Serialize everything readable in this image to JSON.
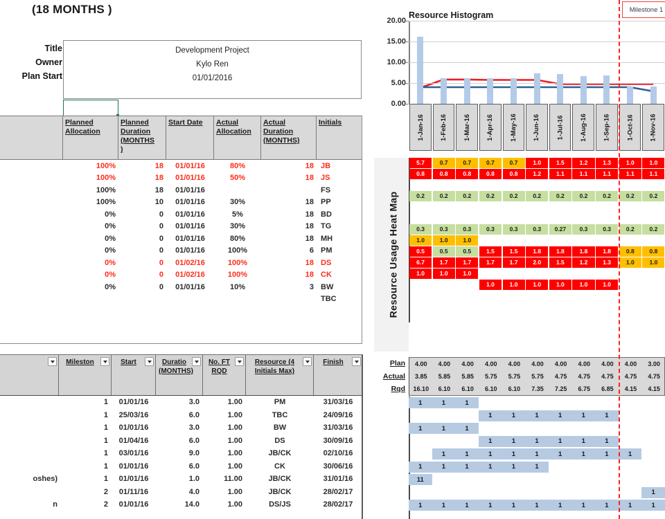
{
  "project": {
    "title_banner": "(18 MONTHS )",
    "labels": [
      "Title",
      "Owner",
      "Plan Start"
    ],
    "values": [
      "Development Project",
      "Kylo Ren",
      "01/01/2016"
    ]
  },
  "resource_table": {
    "headers": [
      "",
      "Planned Allocation",
      "Planned Duration (MONTHS )",
      "Start Date",
      "Actual Allocation",
      "Actual Duration (MONTHS)",
      "Initials"
    ],
    "header_lines": [
      [
        ""
      ],
      [
        "Planned",
        "Allocation"
      ],
      [
        "Planned",
        "Duration",
        "(MONTHS",
        ")"
      ],
      [
        "Start Date"
      ],
      [
        "Actual",
        "Allocation"
      ],
      [
        "Actual",
        "Duration",
        "(MONTHS)"
      ],
      [
        "Initials"
      ]
    ],
    "rows": [
      {
        "planned_allocation": "100%",
        "planned_duration": "18",
        "start_date": "01/01/16",
        "actual_allocation": "80%",
        "actual_duration": "18",
        "initials": "JB",
        "highlight": "red"
      },
      {
        "planned_allocation": "100%",
        "planned_duration": "18",
        "start_date": "01/01/16",
        "actual_allocation": "50%",
        "actual_duration": "18",
        "initials": "JS",
        "highlight": "red"
      },
      {
        "planned_allocation": "100%",
        "planned_duration": "18",
        "start_date": "01/01/16",
        "actual_allocation": "",
        "actual_duration": "",
        "initials": "FS",
        "highlight": "black"
      },
      {
        "planned_allocation": "100%",
        "planned_duration": "10",
        "start_date": "01/01/16",
        "actual_allocation": "30%",
        "actual_duration": "18",
        "initials": "PP",
        "highlight": "black"
      },
      {
        "planned_allocation": "0%",
        "planned_duration": "0",
        "start_date": "01/01/16",
        "actual_allocation": "5%",
        "actual_duration": "18",
        "initials": "BD",
        "highlight": "black"
      },
      {
        "planned_allocation": "0%",
        "planned_duration": "0",
        "start_date": "01/01/16",
        "actual_allocation": "30%",
        "actual_duration": "18",
        "initials": "TG",
        "highlight": "black"
      },
      {
        "planned_allocation": "0%",
        "planned_duration": "0",
        "start_date": "01/01/16",
        "actual_allocation": "80%",
        "actual_duration": "18",
        "initials": "MH",
        "highlight": "black"
      },
      {
        "planned_allocation": "0%",
        "planned_duration": "0",
        "start_date": "01/01/16",
        "actual_allocation": "100%",
        "actual_duration": "6",
        "initials": "PM",
        "highlight": "black"
      },
      {
        "planned_allocation": "0%",
        "planned_duration": "0",
        "start_date": "01/02/16",
        "actual_allocation": "100%",
        "actual_duration": "18",
        "initials": "DS",
        "highlight": "red"
      },
      {
        "planned_allocation": "0%",
        "planned_duration": "0",
        "start_date": "01/02/16",
        "actual_allocation": "100%",
        "actual_duration": "18",
        "initials": "CK",
        "highlight": "red"
      },
      {
        "planned_allocation": "0%",
        "planned_duration": "0",
        "start_date": "01/01/16",
        "actual_allocation": "10%",
        "actual_duration": "3",
        "initials": "BW",
        "highlight": "black"
      },
      {
        "planned_allocation": "",
        "planned_duration": "",
        "start_date": "",
        "actual_allocation": "",
        "actual_duration": "",
        "initials": "TBC",
        "highlight": "black"
      }
    ]
  },
  "task_table": {
    "header_lines": [
      [
        ""
      ],
      [
        "Mileston"
      ],
      [
        "Start"
      ],
      [
        "Duratio",
        "(MONTHS)"
      ],
      [
        "No. FT",
        "RQD"
      ],
      [
        "Resource (4",
        "Initials Max)"
      ],
      [
        "Finish"
      ]
    ],
    "filter_icon": "chevron-down-icon",
    "rows": [
      {
        "desc": "",
        "milestone": "1",
        "start": "01/01/16",
        "duration": "3.0",
        "fte": "1.00",
        "resource": "PM",
        "finish": "31/03/16"
      },
      {
        "desc": "",
        "milestone": "1",
        "start": "25/03/16",
        "duration": "6.0",
        "fte": "1.00",
        "resource": "TBC",
        "finish": "24/09/16"
      },
      {
        "desc": "",
        "milestone": "1",
        "start": "01/01/16",
        "duration": "3.0",
        "fte": "1.00",
        "resource": "BW",
        "finish": "31/03/16"
      },
      {
        "desc": "",
        "milestone": "1",
        "start": "01/04/16",
        "duration": "6.0",
        "fte": "1.00",
        "resource": "DS",
        "finish": "30/09/16"
      },
      {
        "desc": "",
        "milestone": "1",
        "start": "03/01/16",
        "duration": "9.0",
        "fte": "1.00",
        "resource": "JB/CK",
        "finish": "02/10/16"
      },
      {
        "desc": "",
        "milestone": "1",
        "start": "01/01/16",
        "duration": "6.0",
        "fte": "1.00",
        "resource": "CK",
        "finish": "30/06/16"
      },
      {
        "desc": "oshes)",
        "milestone": "1",
        "start": "01/01/16",
        "duration": "1.0",
        "fte": "11.00",
        "resource": "JB/CK",
        "finish": "31/01/16"
      },
      {
        "desc": "",
        "milestone": "2",
        "start": "01/11/16",
        "duration": "4.0",
        "fte": "1.00",
        "resource": "JB/CK",
        "finish": "28/02/17"
      },
      {
        "desc": "n",
        "milestone": "2",
        "start": "01/01/16",
        "duration": "14.0",
        "fte": "1.00",
        "resource": "DS/JS",
        "finish": "28/02/17"
      }
    ]
  },
  "milestone": {
    "label": "Milestone 1",
    "at_column": 9
  },
  "heatmap": {
    "title": "Resource Usage Heat Map",
    "colors": {
      "red": "#ff0000",
      "amber": "#ffbf00",
      "green": "#c6dea0"
    },
    "rows": [
      {
        "cells": [
          {
            "v": "5.7",
            "c": "red"
          },
          {
            "v": "0.7",
            "c": "amber"
          },
          {
            "v": "0.7",
            "c": "amber"
          },
          {
            "v": "0.7",
            "c": "amber"
          },
          {
            "v": "0.7",
            "c": "amber"
          },
          {
            "v": "1.0",
            "c": "red"
          },
          {
            "v": "1.5",
            "c": "red"
          },
          {
            "v": "1.2",
            "c": "red"
          },
          {
            "v": "1.3",
            "c": "red"
          },
          {
            "v": "1.0",
            "c": "red"
          },
          {
            "v": "1.0",
            "c": "red"
          }
        ]
      },
      {
        "cells": [
          {
            "v": "0.8",
            "c": "red"
          },
          {
            "v": "0.8",
            "c": "red"
          },
          {
            "v": "0.8",
            "c": "red"
          },
          {
            "v": "0.8",
            "c": "red"
          },
          {
            "v": "0.8",
            "c": "red"
          },
          {
            "v": "1.2",
            "c": "red"
          },
          {
            "v": "1.1",
            "c": "red"
          },
          {
            "v": "1.1",
            "c": "red"
          },
          {
            "v": "1.1",
            "c": "red"
          },
          {
            "v": "1.1",
            "c": "red"
          },
          {
            "v": "1.1",
            "c": "red"
          }
        ]
      },
      {
        "cells": []
      },
      {
        "cells": [
          {
            "v": "0.2",
            "c": "green"
          },
          {
            "v": "0.2",
            "c": "green"
          },
          {
            "v": "0.2",
            "c": "green"
          },
          {
            "v": "0.2",
            "c": "green"
          },
          {
            "v": "0.2",
            "c": "green"
          },
          {
            "v": "0.2",
            "c": "green"
          },
          {
            "v": "0.2",
            "c": "green"
          },
          {
            "v": "0.2",
            "c": "green"
          },
          {
            "v": "0.2",
            "c": "green"
          },
          {
            "v": "0.2",
            "c": "green"
          },
          {
            "v": "0.2",
            "c": "green"
          }
        ]
      },
      {
        "cells": []
      },
      {
        "cells": []
      },
      {
        "cells": [
          {
            "v": "0.3",
            "c": "green"
          },
          {
            "v": "0.3",
            "c": "green"
          },
          {
            "v": "0.3",
            "c": "green"
          },
          {
            "v": "0.3",
            "c": "green"
          },
          {
            "v": "0.3",
            "c": "green"
          },
          {
            "v": "0.3",
            "c": "green"
          },
          {
            "v": "0.27",
            "c": "green"
          },
          {
            "v": "0.3",
            "c": "green"
          },
          {
            "v": "0.3",
            "c": "green"
          },
          {
            "v": "0.2",
            "c": "green"
          },
          {
            "v": "0.2",
            "c": "green"
          }
        ]
      },
      {
        "cells": [
          {
            "v": "1.0",
            "c": "amber"
          },
          {
            "v": "1.0",
            "c": "amber"
          },
          {
            "v": "1.0",
            "c": "amber"
          },
          null,
          null,
          null,
          null,
          null,
          null,
          null,
          null
        ]
      },
      {
        "cells": [
          {
            "v": "0.5",
            "c": "red"
          },
          {
            "v": "0.5",
            "c": "green"
          },
          {
            "v": "0.5",
            "c": "green"
          },
          {
            "v": "1.5",
            "c": "red"
          },
          {
            "v": "1.5",
            "c": "red"
          },
          {
            "v": "1.8",
            "c": "red"
          },
          {
            "v": "1.8",
            "c": "red"
          },
          {
            "v": "1.8",
            "c": "red"
          },
          {
            "v": "1.8",
            "c": "red"
          },
          {
            "v": "0.8",
            "c": "amber"
          },
          {
            "v": "0.8",
            "c": "amber"
          }
        ]
      },
      {
        "cells": [
          {
            "v": "6.7",
            "c": "red"
          },
          {
            "v": "1.7",
            "c": "red"
          },
          {
            "v": "1.7",
            "c": "red"
          },
          {
            "v": "1.7",
            "c": "red"
          },
          {
            "v": "1.7",
            "c": "red"
          },
          {
            "v": "2.0",
            "c": "red"
          },
          {
            "v": "1.5",
            "c": "red"
          },
          {
            "v": "1.2",
            "c": "red"
          },
          {
            "v": "1.3",
            "c": "red"
          },
          {
            "v": "1.0",
            "c": "amber"
          },
          {
            "v": "1.0",
            "c": "amber"
          }
        ]
      },
      {
        "cells": [
          {
            "v": "1.0",
            "c": "red"
          },
          {
            "v": "1.0",
            "c": "red"
          },
          {
            "v": "1.0",
            "c": "red"
          },
          null,
          null,
          null,
          null,
          null,
          null,
          null,
          null
        ]
      },
      {
        "cells": [
          null,
          null,
          null,
          {
            "v": "1.0",
            "c": "red"
          },
          {
            "v": "1.0",
            "c": "red"
          },
          {
            "v": "1.0",
            "c": "red"
          },
          {
            "v": "1.0",
            "c": "red"
          },
          {
            "v": "1.0",
            "c": "red"
          },
          {
            "v": "1.0",
            "c": "red"
          },
          null,
          null
        ]
      }
    ]
  },
  "summary": {
    "row_labels": [
      "Plan",
      "Actual",
      "Rqd"
    ],
    "plan": [
      "4.00",
      "4.00",
      "4.00",
      "4.00",
      "4.00",
      "4.00",
      "4.00",
      "4.00",
      "4.00",
      "4.00",
      "3.00"
    ],
    "actual": [
      "3.85",
      "5.85",
      "5.85",
      "5.75",
      "5.75",
      "5.75",
      "4.75",
      "4.75",
      "4.75",
      "4.75",
      "4.75"
    ],
    "rqd": [
      "16.10",
      "6.10",
      "6.10",
      "6.10",
      "6.10",
      "7.35",
      "7.25",
      "6.75",
      "6.85",
      "4.15",
      "4.15"
    ]
  },
  "bottom_gantt": {
    "value": "1",
    "value_alt": "11",
    "rows": [
      {
        "start": 0,
        "span": 3,
        "label": "1"
      },
      {
        "start": 3,
        "span": 6,
        "label": "1"
      },
      {
        "start": 0,
        "span": 3,
        "label": "1"
      },
      {
        "start": 3,
        "span": 6,
        "label": "1"
      },
      {
        "start": 1,
        "span": 9,
        "label": "1"
      },
      {
        "start": 0,
        "span": 6,
        "label": "1"
      },
      {
        "start": 0,
        "span": 1,
        "label": "11"
      },
      {
        "start": 10,
        "span": 1,
        "label": "1"
      },
      {
        "start": 0,
        "span": 11,
        "label": "1"
      }
    ]
  },
  "chart_data": {
    "type": "bar",
    "title": "Resource Histogram",
    "categories": [
      "1-Jan-16",
      "1-Feb-16",
      "1-Mar-16",
      "1-Apr-16",
      "1-May-16",
      "1-Jun-16",
      "1-Jul-16",
      "1-Aug-16",
      "1-Sep-16",
      "1-Oct-16",
      "1-Nov-16"
    ],
    "ylim": [
      0,
      20
    ],
    "yticks": [
      "0.00",
      "5.00",
      "10.00",
      "15.00",
      "20.00"
    ],
    "xlabel": "",
    "ylabel": "",
    "grid": true,
    "legend_position": "none",
    "series": [
      {
        "name": "Rqd",
        "type": "bar",
        "color": "#b3cbe8",
        "values": [
          16.1,
          6.1,
          6.1,
          6.1,
          6.1,
          7.35,
          7.25,
          6.75,
          6.85,
          4.15,
          4.15
        ]
      },
      {
        "name": "Actual",
        "type": "line",
        "color": "#ee1c25",
        "values": [
          3.85,
          5.85,
          5.85,
          5.75,
          5.75,
          5.75,
          4.75,
          4.75,
          4.75,
          4.75,
          4.75
        ]
      },
      {
        "name": "Plan",
        "type": "line",
        "color": "#2e5f94",
        "values": [
          4.0,
          4.0,
          4.0,
          4.0,
          4.0,
          4.0,
          4.0,
          4.0,
          4.0,
          4.0,
          3.0
        ]
      }
    ],
    "annotations": [
      {
        "label": "Milestone 1",
        "x_category": "1-Oct-16",
        "color": "#ff1f1f",
        "style": "dashed-vertical"
      }
    ]
  }
}
